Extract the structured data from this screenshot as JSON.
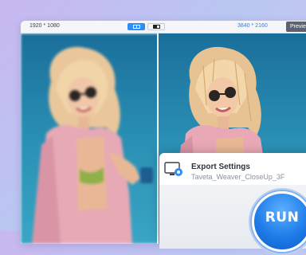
{
  "toolbar": {
    "source_resolution": "1920 * 1080",
    "output_resolution": "3840 * 2160",
    "preview_label": "Previe"
  },
  "export": {
    "title": "Export Settings",
    "filename": "Taveta_Weaver_CloseUp_3F"
  },
  "run_button": {
    "label": "RUN"
  },
  "colors": {
    "accent": "#2f8ef5",
    "run_button": "#1f7ce8"
  }
}
